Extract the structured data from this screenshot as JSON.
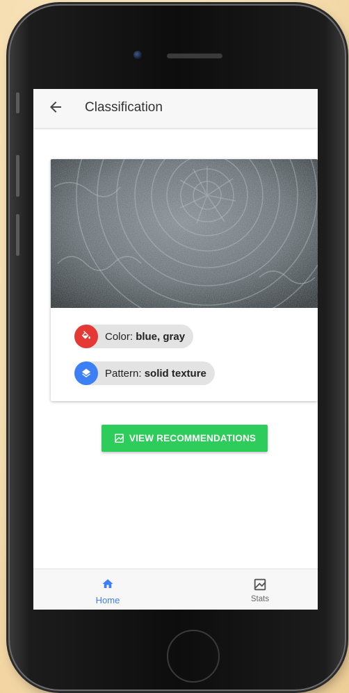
{
  "header": {
    "title": "Classification"
  },
  "result": {
    "chips": [
      {
        "prefix": "Color:",
        "value": "blue, gray",
        "icon": "paint-bucket-icon",
        "color": "#e53935"
      },
      {
        "prefix": "Pattern:",
        "value": "solid texture",
        "icon": "layers-icon",
        "color": "#3d7ff5"
      }
    ]
  },
  "actions": {
    "recommend_label": "VIEW RECOMMENDATIONS",
    "button_color": "#2ecc5a"
  },
  "tabs": [
    {
      "label": "Home",
      "icon": "home-icon",
      "active": true,
      "color": "#3d7ff5"
    },
    {
      "label": "Stats",
      "icon": "chart-icon",
      "active": false,
      "color": "#555555"
    }
  ]
}
